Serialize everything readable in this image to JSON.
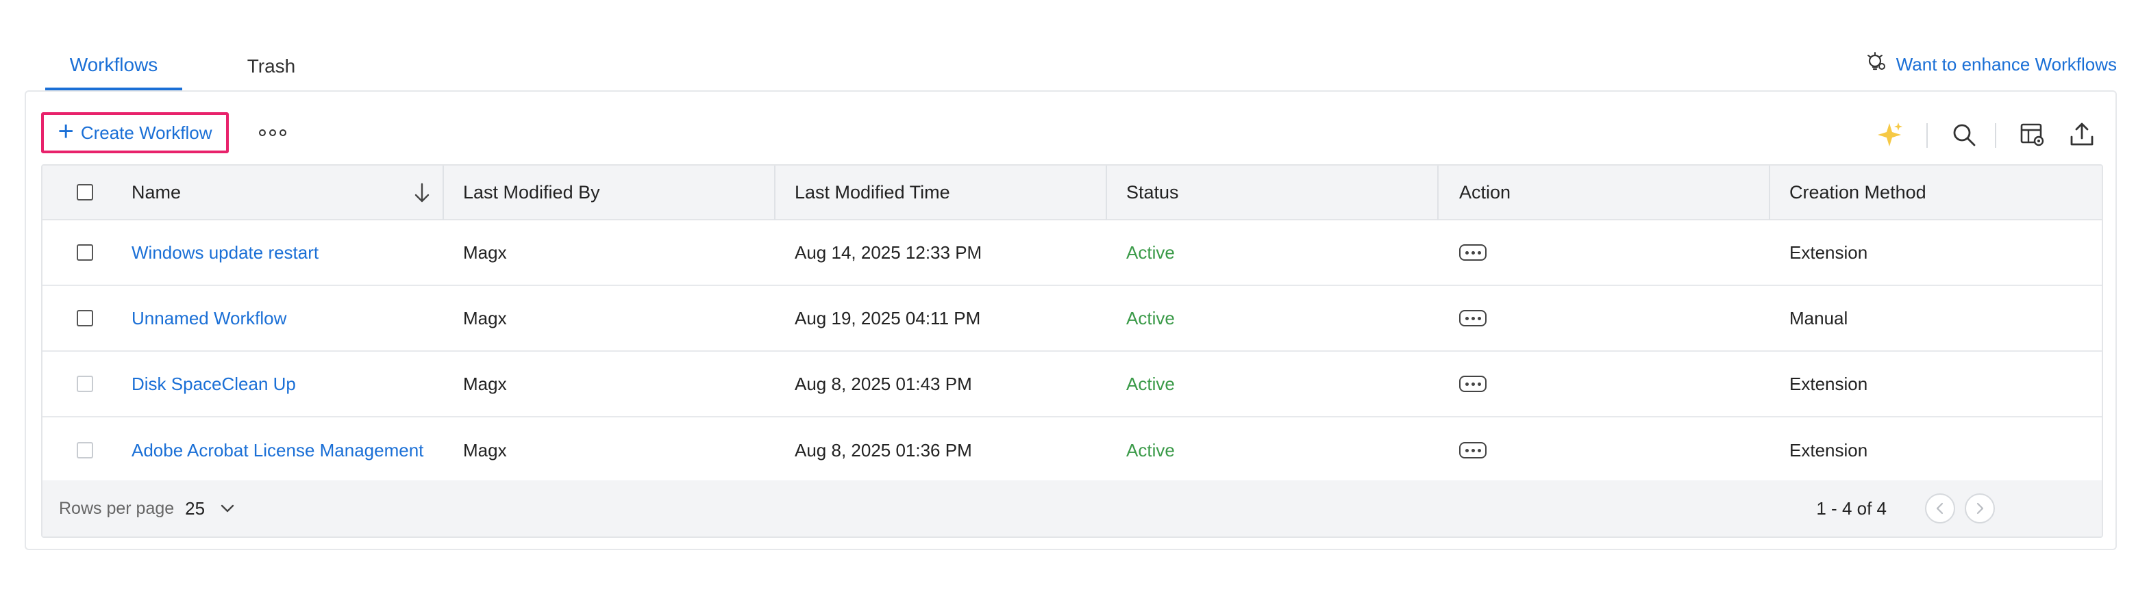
{
  "tabs": [
    {
      "label": "Workflows",
      "active": true
    },
    {
      "label": "Trash",
      "active": false
    }
  ],
  "enhance_link": "Want to enhance Workflows",
  "toolbar": {
    "create_label": "Create Workflow"
  },
  "table": {
    "headers": {
      "name": "Name",
      "modified_by": "Last Modified By",
      "modified_time": "Last Modified Time",
      "status": "Status",
      "action": "Action",
      "creation_method": "Creation Method"
    },
    "rows": [
      {
        "name": "Windows update restart",
        "modified_by": "Magx",
        "modified_time": "Aug 14, 2025 12:33 PM",
        "status": "Active",
        "creation_method": "Extension"
      },
      {
        "name": "Unnamed Workflow",
        "modified_by": "Magx",
        "modified_time": "Aug 19, 2025 04:11 PM",
        "status": "Active",
        "creation_method": "Manual"
      },
      {
        "name": "Disk SpaceClean Up",
        "modified_by": "Magx",
        "modified_time": "Aug 8, 2025 01:43 PM",
        "status": "Active",
        "creation_method": "Extension"
      },
      {
        "name": "Adobe Acrobat License Management",
        "modified_by": "Magx",
        "modified_time": "Aug 8, 2025 01:36 PM",
        "status": "Active",
        "creation_method": "Extension"
      }
    ]
  },
  "pagination": {
    "rows_per_page_label": "Rows per page",
    "rows_per_page": "25",
    "range": "1 - 4 of 4"
  },
  "colors": {
    "accent": "#1a6fd6",
    "highlight_border": "#e8226b",
    "status_active": "#3a9a48",
    "sparkle": "#f6c945"
  }
}
